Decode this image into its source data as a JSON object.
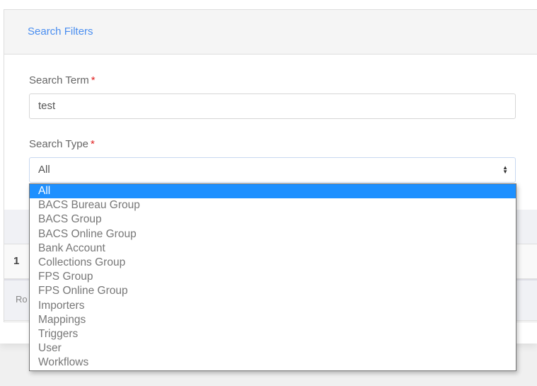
{
  "card": {
    "title": "Search Filters"
  },
  "search_term": {
    "label": "Search Term",
    "required_mark": "*",
    "value": "test"
  },
  "search_type": {
    "label": "Search Type",
    "required_mark": "*",
    "value": "All",
    "arrow_icon": "up-down-caret-icon",
    "options": [
      "All",
      "BACS Bureau Group",
      "BACS Group",
      "BACS Online Group",
      "Bank Account",
      "Collections Group",
      "FPS Group",
      "FPS Online Group",
      "Importers",
      "Mappings",
      "Triggers",
      "User",
      "Workflows"
    ],
    "selected_index": 0
  },
  "table": {
    "row_number": "1",
    "footer_partial": "Ro"
  },
  "colors": {
    "accent": "#4a8ef0",
    "selected_option": "#1e90ff",
    "required": "#e02020"
  }
}
